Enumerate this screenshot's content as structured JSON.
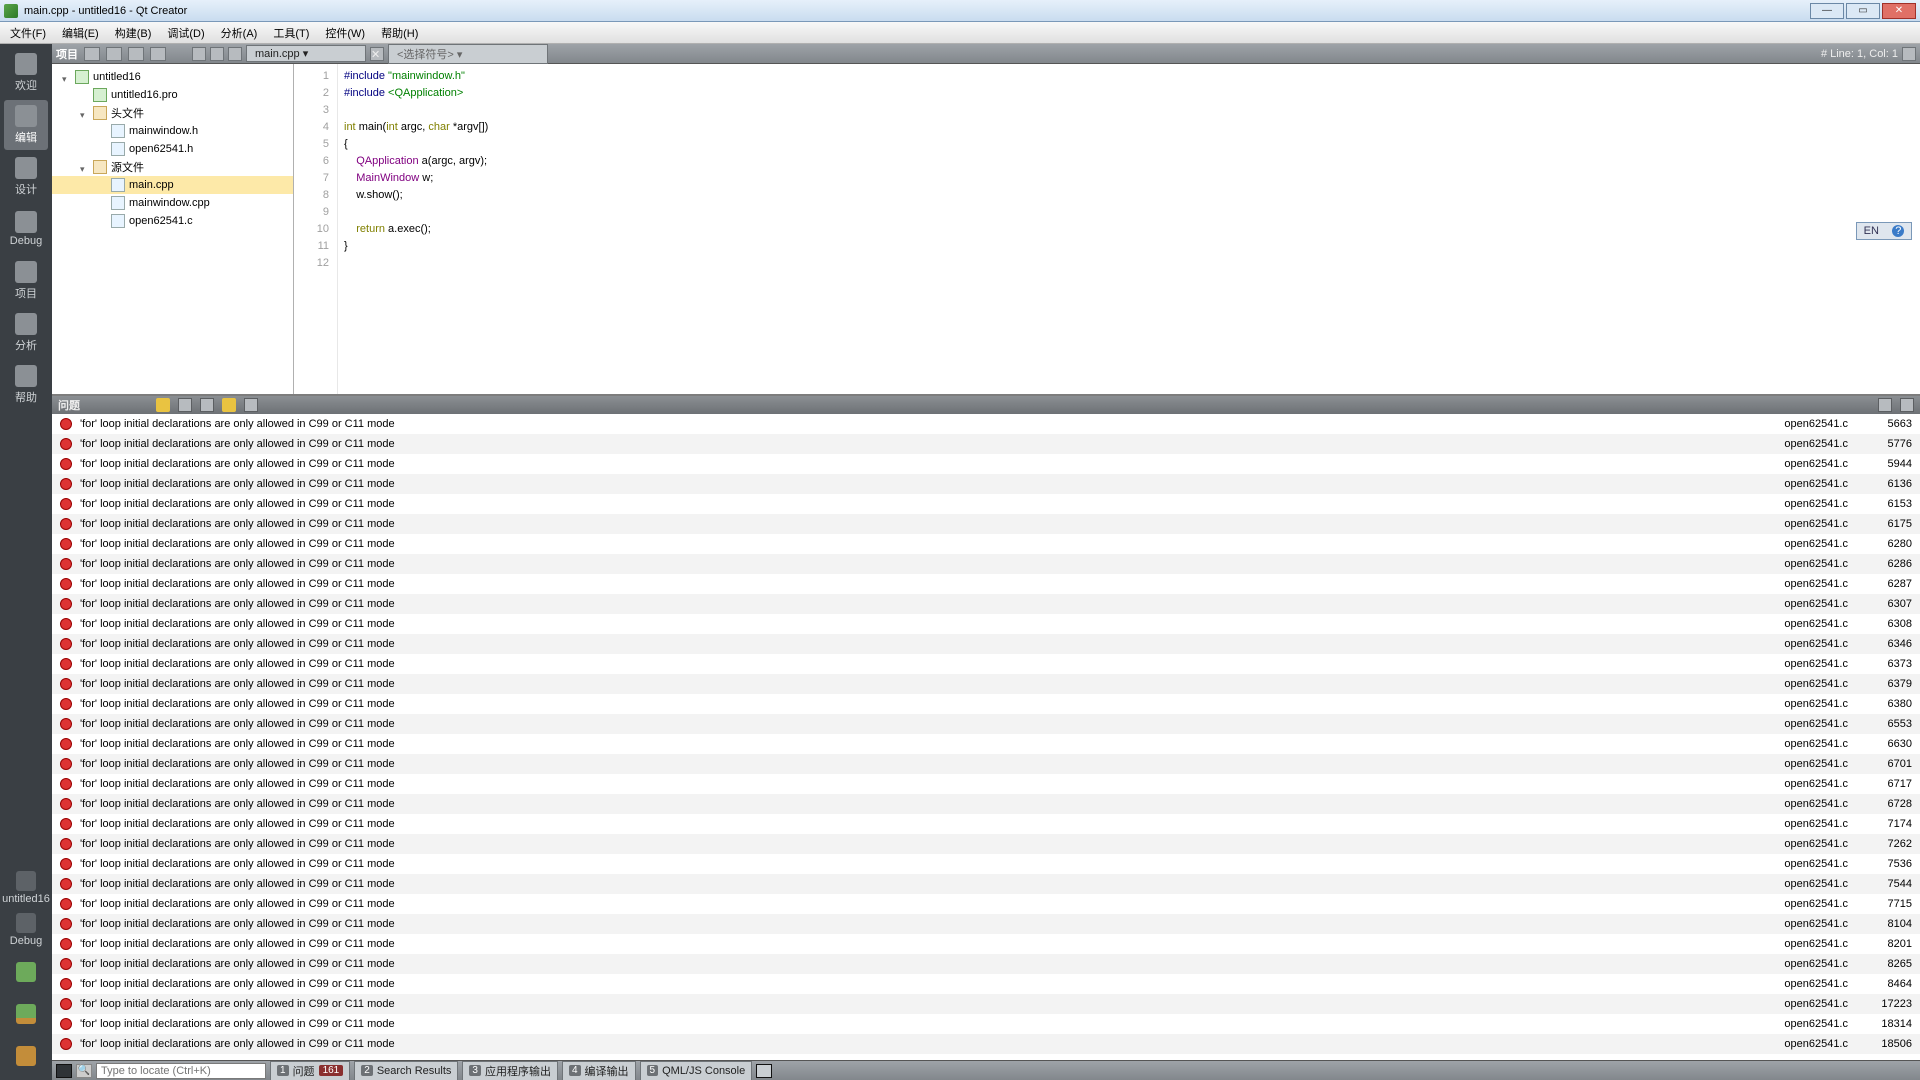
{
  "window": {
    "title": "main.cpp - untitled16 - Qt Creator"
  },
  "menu": {
    "items": [
      "文件(F)",
      "编辑(E)",
      "构建(B)",
      "调试(D)",
      "分析(A)",
      "工具(T)",
      "控件(W)",
      "帮助(H)"
    ]
  },
  "modebar": {
    "items": [
      {
        "label": "欢迎",
        "name": "mode-welcome"
      },
      {
        "label": "编辑",
        "name": "mode-edit",
        "active": true
      },
      {
        "label": "设计",
        "name": "mode-design"
      },
      {
        "label": "Debug",
        "name": "mode-debug"
      },
      {
        "label": "项目",
        "name": "mode-projects"
      },
      {
        "label": "分析",
        "name": "mode-analyze"
      },
      {
        "label": "帮助",
        "name": "mode-help"
      }
    ],
    "kit_label": "untitled16",
    "debug_label": "Debug"
  },
  "header": {
    "project_label": "项目",
    "file_name": "main.cpp",
    "symbols_label": "<选择符号>",
    "cursor_status": "# Line: 1, Col: 1"
  },
  "project_tree": {
    "nodes": [
      {
        "depth": 0,
        "icon": "pro",
        "label": "untitled16",
        "caret": "open"
      },
      {
        "depth": 1,
        "icon": "pro",
        "label": "untitled16.pro"
      },
      {
        "depth": 1,
        "icon": "folder",
        "label": "头文件",
        "caret": "open"
      },
      {
        "depth": 2,
        "icon": "file",
        "label": "mainwindow.h"
      },
      {
        "depth": 2,
        "icon": "file",
        "label": "open62541.h"
      },
      {
        "depth": 1,
        "icon": "folder",
        "label": "源文件",
        "caret": "open"
      },
      {
        "depth": 2,
        "icon": "file",
        "label": "main.cpp",
        "selected": true
      },
      {
        "depth": 2,
        "icon": "file",
        "label": "mainwindow.cpp"
      },
      {
        "depth": 2,
        "icon": "file",
        "label": "open62541.c"
      }
    ]
  },
  "code": {
    "lines": [
      {
        "n": 1,
        "segs": [
          {
            "t": "#include ",
            "c": "pp"
          },
          {
            "t": "\"mainwindow.h\"",
            "c": "str"
          }
        ]
      },
      {
        "n": 2,
        "segs": [
          {
            "t": "#include ",
            "c": "pp"
          },
          {
            "t": "<QApplication>",
            "c": "str"
          }
        ]
      },
      {
        "n": 3,
        "segs": []
      },
      {
        "n": 4,
        "segs": [
          {
            "t": "int ",
            "c": "kw"
          },
          {
            "t": "main(",
            "c": ""
          },
          {
            "t": "int ",
            "c": "kw"
          },
          {
            "t": "argc, ",
            "c": ""
          },
          {
            "t": "char ",
            "c": "kw"
          },
          {
            "t": "*argv[])",
            "c": ""
          }
        ]
      },
      {
        "n": 5,
        "segs": [
          {
            "t": "{",
            "c": ""
          }
        ]
      },
      {
        "n": 6,
        "segs": [
          {
            "t": "    ",
            "c": ""
          },
          {
            "t": "QApplication ",
            "c": "type"
          },
          {
            "t": "a(argc, argv);",
            "c": ""
          }
        ]
      },
      {
        "n": 7,
        "segs": [
          {
            "t": "    ",
            "c": ""
          },
          {
            "t": "MainWindow ",
            "c": "type"
          },
          {
            "t": "w;",
            "c": ""
          }
        ]
      },
      {
        "n": 8,
        "segs": [
          {
            "t": "    w.show();",
            "c": ""
          }
        ]
      },
      {
        "n": 9,
        "segs": []
      },
      {
        "n": 10,
        "segs": [
          {
            "t": "    ",
            "c": ""
          },
          {
            "t": "return ",
            "c": "kw"
          },
          {
            "t": "a.exec();",
            "c": ""
          }
        ]
      },
      {
        "n": 11,
        "segs": [
          {
            "t": "}",
            "c": ""
          }
        ]
      },
      {
        "n": 12,
        "segs": []
      }
    ]
  },
  "langbar": {
    "lang": "EN"
  },
  "issues": {
    "title": "问题",
    "common_msg": "'for' loop initial declarations are only allowed in C99 or C11 mode",
    "file": "open62541.c",
    "lines": [
      5663,
      5776,
      5944,
      6136,
      6153,
      6175,
      6280,
      6286,
      6287,
      6307,
      6308,
      6346,
      6373,
      6379,
      6380,
      6553,
      6630,
      6701,
      6717,
      6728,
      7174,
      7262,
      7536,
      7544,
      7715,
      8104,
      8201,
      8265,
      8464,
      17223,
      18314,
      18506
    ]
  },
  "bottombar": {
    "placeholder": "Type to locate (Ctrl+K)",
    "tabs": [
      {
        "num": "1",
        "label": "问题",
        "badge": "161"
      },
      {
        "num": "2",
        "label": "Search Results"
      },
      {
        "num": "3",
        "label": "应用程序输出"
      },
      {
        "num": "4",
        "label": "编译输出"
      },
      {
        "num": "5",
        "label": "QML/JS Console"
      }
    ]
  }
}
